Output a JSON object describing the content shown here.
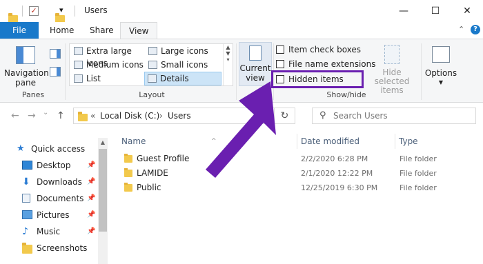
{
  "window": {
    "title": "Users",
    "minimize": "—",
    "maximize": "☐",
    "close": "✕"
  },
  "tabs": [
    {
      "label": "File"
    },
    {
      "label": "Home"
    },
    {
      "label": "Share"
    },
    {
      "label": "View"
    }
  ],
  "ribbon": {
    "collapse": "⌃",
    "help": "?",
    "panes": {
      "nav_pane_line1": "Navigation",
      "nav_pane_line2": "pane",
      "group_label": "Panes"
    },
    "layout": {
      "items": [
        {
          "label": "Extra large icons"
        },
        {
          "label": "Large icons"
        },
        {
          "label": "Medium icons"
        },
        {
          "label": "Small icons"
        },
        {
          "label": "List"
        },
        {
          "label": "Details"
        }
      ],
      "group_label": "Layout"
    },
    "current_view": {
      "line1": "Current",
      "line2": "view"
    },
    "show_hide": {
      "item_check_boxes": "Item check boxes",
      "file_name_extensions": "File name extensions",
      "hidden_items": "Hidden items",
      "hide_selected_line1": "Hide selected",
      "hide_selected_line2": "items",
      "group_label": "Show/hide"
    },
    "options": {
      "label": "Options"
    }
  },
  "address": {
    "back": "←",
    "forward": "→",
    "recent": "⌄",
    "up": "↑",
    "crumb_prefix": "«",
    "crumb_1": "Local Disk (C:)",
    "crumb_sep": "›",
    "crumb_2": "Users",
    "dropdown": "⌄",
    "refresh": "↻",
    "search_placeholder": "Search Users"
  },
  "nav_pane": {
    "items": [
      {
        "label": "Quick access"
      },
      {
        "label": "Desktop"
      },
      {
        "label": "Downloads"
      },
      {
        "label": "Documents"
      },
      {
        "label": "Pictures"
      },
      {
        "label": "Music"
      },
      {
        "label": "Screenshots"
      }
    ]
  },
  "file_list": {
    "columns": {
      "name": "Name",
      "date_modified": "Date modified",
      "type": "Type"
    },
    "rows": [
      {
        "name": "Guest Profile",
        "date": "2/2/2020 6:28 PM",
        "type": "File folder"
      },
      {
        "name": "LAMIDE",
        "date": "2/1/2020 12:22 PM",
        "type": "File folder"
      },
      {
        "name": "Public",
        "date": "12/25/2019 6:30 PM",
        "type": "File folder"
      }
    ]
  },
  "colors": {
    "accent": "#1979ca",
    "annotation": "#6a1fb0"
  }
}
